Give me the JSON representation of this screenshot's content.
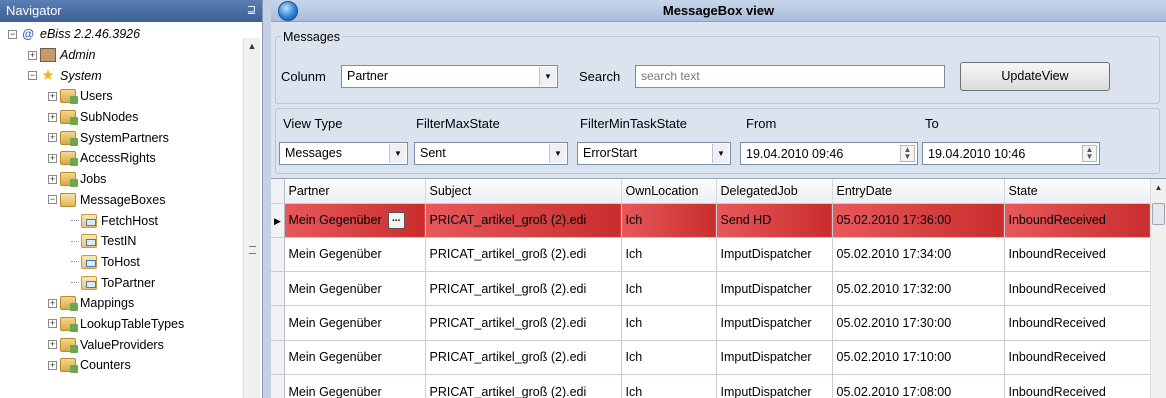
{
  "navigator": {
    "title": "Navigator",
    "pin": "⊒",
    "tree": [
      {
        "label": "eBiss 2.2.46.3926",
        "level": 0,
        "expander": "−",
        "icon": "ebiss-icon",
        "italic": true
      },
      {
        "label": "Admin",
        "level": 1,
        "expander": "+",
        "icon": "admin-icon",
        "italic": true
      },
      {
        "label": "System",
        "level": 1,
        "expander": "−",
        "icon": "star-icon",
        "italic": true
      },
      {
        "label": "Users",
        "level": 2,
        "expander": "+",
        "icon": "folder-icon"
      },
      {
        "label": "SubNodes",
        "level": 2,
        "expander": "+",
        "icon": "folder-icon"
      },
      {
        "label": "SystemPartners",
        "level": 2,
        "expander": "+",
        "icon": "folder-icon"
      },
      {
        "label": "AccessRights",
        "level": 2,
        "expander": "+",
        "icon": "folder-icon"
      },
      {
        "label": "Jobs",
        "level": 2,
        "expander": "+",
        "icon": "folder-icon"
      },
      {
        "label": "MessageBoxes",
        "level": 2,
        "expander": "−",
        "icon": "open-folder-icon"
      },
      {
        "label": "FetchHost",
        "level": 3,
        "icon": "message-folder-icon"
      },
      {
        "label": "TestIN",
        "level": 3,
        "icon": "message-folder-icon"
      },
      {
        "label": "ToHost",
        "level": 3,
        "icon": "message-folder-icon"
      },
      {
        "label": "ToPartner",
        "level": 3,
        "icon": "message-folder-icon"
      },
      {
        "label": "Mappings",
        "level": 2,
        "expander": "+",
        "icon": "folder-icon"
      },
      {
        "label": "LookupTableTypes",
        "level": 2,
        "expander": "+",
        "icon": "folder-icon"
      },
      {
        "label": "ValueProviders",
        "level": 2,
        "expander": "+",
        "icon": "folder-icon"
      },
      {
        "label": "Counters",
        "level": 2,
        "expander": "+",
        "icon": "folder-icon"
      }
    ]
  },
  "main": {
    "title": "MessageBox view",
    "messages_group": "Messages",
    "column_label": "Colunm",
    "column_value": "Partner",
    "search_label": "Search",
    "search_placeholder": "search text",
    "update_button": "UpdateView",
    "filters": {
      "view_type_label": "View Type",
      "view_type_value": "Messages",
      "max_state_label": "FilterMaxState",
      "max_state_value": "Sent",
      "min_task_label": "FilterMinTaskState",
      "min_task_value": "ErrorStart",
      "from_label": "From",
      "from_value": "19.04.2010 09:46",
      "to_label": "To",
      "to_value": "19.04.2010 10:46"
    }
  },
  "grid": {
    "columns": [
      "Partner",
      "Subject",
      "OwnLocation",
      "DelegatedJob",
      "EntryDate",
      "State"
    ],
    "rows": [
      [
        "Mein Gegenüber",
        "PRICAT_artikel_groß (2).edi",
        "Ich",
        "Send HD",
        "05.02.2010 17:36:00",
        "InboundReceived"
      ],
      [
        "Mein Gegenüber",
        "PRICAT_artikel_groß (2).edi",
        "Ich",
        "ImputDispatcher",
        "05.02.2010 17:34:00",
        "InboundReceived"
      ],
      [
        "Mein Gegenüber",
        "PRICAT_artikel_groß (2).edi",
        "Ich",
        "ImputDispatcher",
        "05.02.2010 17:32:00",
        "InboundReceived"
      ],
      [
        "Mein Gegenüber",
        "PRICAT_artikel_groß (2).edi",
        "Ich",
        "ImputDispatcher",
        "05.02.2010 17:30:00",
        "InboundReceived"
      ],
      [
        "Mein Gegenüber",
        "PRICAT_artikel_groß (2).edi",
        "Ich",
        "ImputDispatcher",
        "05.02.2010 17:10:00",
        "InboundReceived"
      ],
      [
        "Mein Gegenüber",
        "PRICAT_artikel_groß (2).edi",
        "Ich",
        "ImputDispatcher",
        "05.02.2010 17:08:00",
        "InboundReceived"
      ]
    ],
    "selected_row": 0,
    "selected_color": "#d63a3a"
  }
}
